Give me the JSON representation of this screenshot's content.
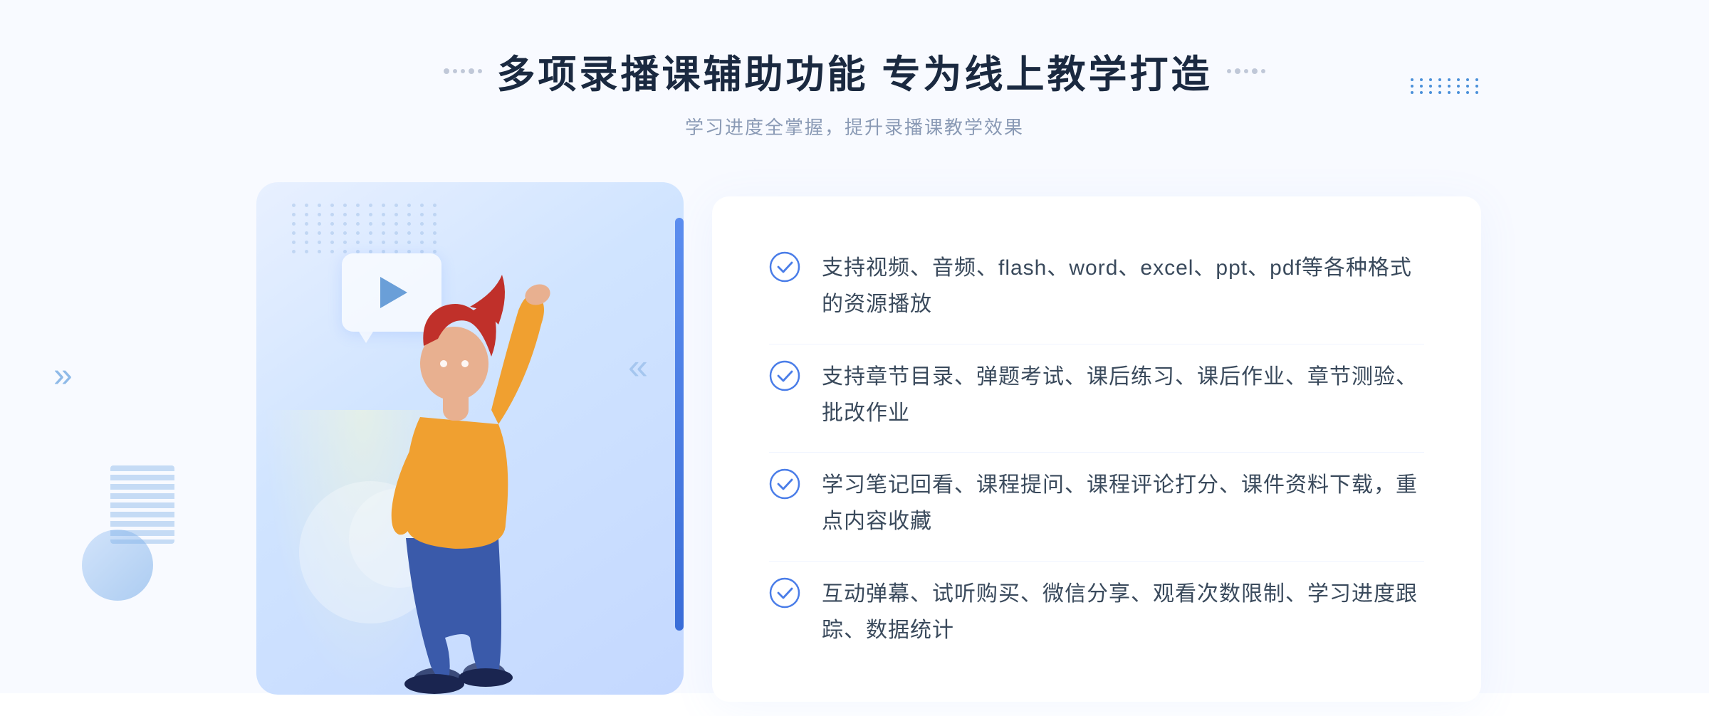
{
  "header": {
    "title": "多项录播课辅助功能 专为线上教学打造",
    "subtitle": "学习进度全掌握，提升录播课教学效果"
  },
  "features": [
    {
      "id": "feature-1",
      "text": "支持视频、音频、flash、word、excel、ppt、pdf等各种格式的资源播放"
    },
    {
      "id": "feature-2",
      "text": "支持章节目录、弹题考试、课后练习、课后作业、章节测验、批改作业"
    },
    {
      "id": "feature-3",
      "text": "学习笔记回看、课程提问、课程评论打分、课件资料下载，重点内容收藏"
    },
    {
      "id": "feature-4",
      "text": "互动弹幕、试听购买、微信分享、观看次数限制、学习进度跟踪、数据统计"
    }
  ],
  "colors": {
    "primary_blue": "#4a7de8",
    "light_blue": "#e8f0ff",
    "text_dark": "#1a2940",
    "text_gray": "#8a9ab5",
    "text_body": "#3a4a5c",
    "check_color": "#4a7de8"
  },
  "decorations": {
    "chevron_symbol": "»",
    "dots_label": "decoration-dots"
  }
}
